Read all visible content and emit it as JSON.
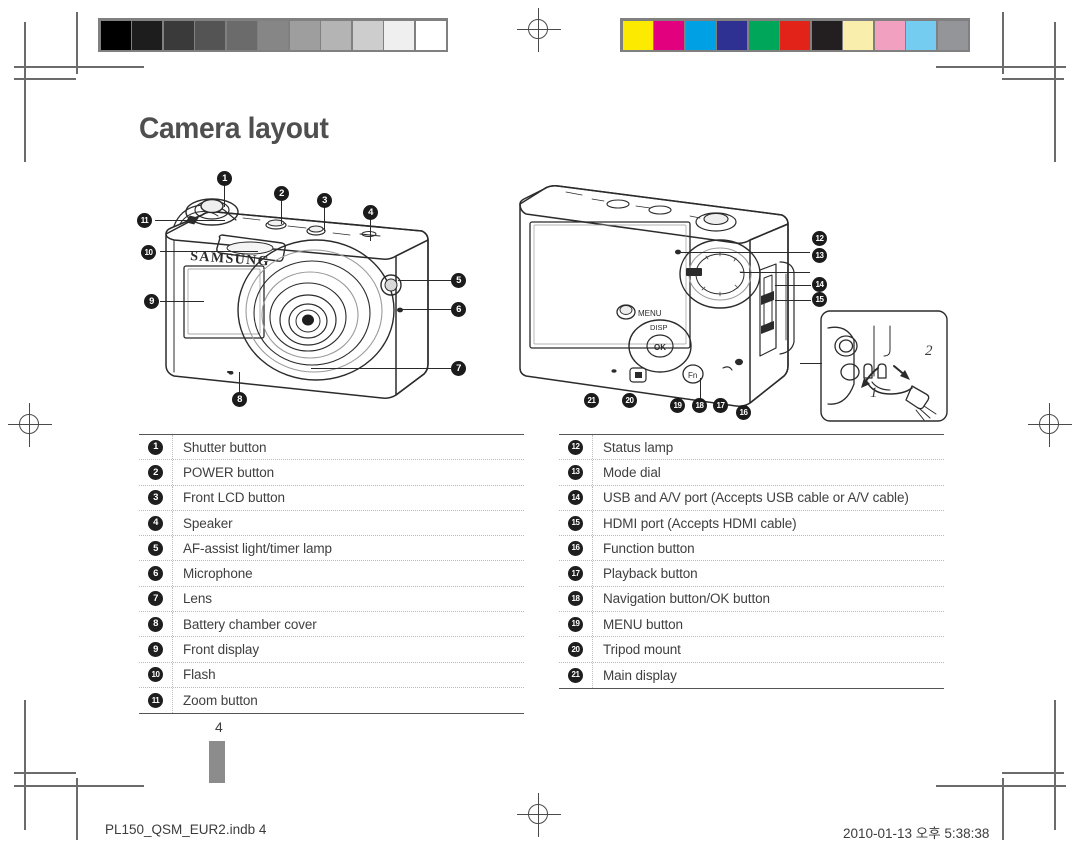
{
  "document": {
    "page_title": "Camera layout",
    "page_number": "4",
    "footer_file": "PL150_QSM_EUR2.indb   4",
    "footer_timestamp": "2010-01-13   오후 5:38:38"
  },
  "print_strips": {
    "grayscale_label": "grayscale-control-strip",
    "grayscale": [
      "#000000",
      "#1d1d1d",
      "#3a3a3a",
      "#545454",
      "#6b6b6b",
      "#868686",
      "#9e9e9e",
      "#b4b4b4",
      "#cdcdcd",
      "#efefef",
      "#ffffff"
    ],
    "color_label": "color-control-strip",
    "colors": [
      "#fcea00",
      "#e3007f",
      "#00a0e4",
      "#2e3192",
      "#00a65a",
      "#e2231a",
      "#231f20",
      "#faeeac",
      "#f2a0c0",
      "#74cdf0",
      "#939598"
    ]
  },
  "illustrations": {
    "front": {
      "name": "camera-front-illustration",
      "brand_text": "SAMSUNG",
      "callouts": [
        "1",
        "2",
        "3",
        "4",
        "5",
        "6",
        "7",
        "8",
        "9",
        "10",
        "11"
      ]
    },
    "rear": {
      "name": "camera-rear-illustration",
      "menu_text": "MENU",
      "disp_text": "DISP",
      "ok_text": "OK",
      "fn_text": "Fn",
      "callouts": [
        "12",
        "13",
        "14",
        "15",
        "16",
        "17",
        "18",
        "19",
        "20",
        "21"
      ]
    },
    "inset": {
      "name": "cable-connection-inset",
      "step_one": "1",
      "step_two": "2"
    }
  },
  "legend_left": [
    {
      "num": "1",
      "label": "Shutter button"
    },
    {
      "num": "2",
      "label": "POWER button"
    },
    {
      "num": "3",
      "label": "Front LCD button"
    },
    {
      "num": "4",
      "label": "Speaker"
    },
    {
      "num": "5",
      "label": "AF-assist light/timer lamp"
    },
    {
      "num": "6",
      "label": "Microphone"
    },
    {
      "num": "7",
      "label": "Lens"
    },
    {
      "num": "8",
      "label": "Battery chamber cover"
    },
    {
      "num": "9",
      "label": "Front display"
    },
    {
      "num": "10",
      "label": "Flash"
    },
    {
      "num": "11",
      "label": "Zoom button"
    }
  ],
  "legend_right": [
    {
      "num": "12",
      "label": "Status lamp"
    },
    {
      "num": "13",
      "label": "Mode dial"
    },
    {
      "num": "14",
      "label": "USB and A/V port (Accepts USB cable or A/V cable)"
    },
    {
      "num": "15",
      "label": "HDMI port (Accepts HDMI cable)"
    },
    {
      "num": "16",
      "label": "Function button"
    },
    {
      "num": "17",
      "label": "Playback button"
    },
    {
      "num": "18",
      "label": "Navigation button/OK button"
    },
    {
      "num": "19",
      "label": "MENU button"
    },
    {
      "num": "20",
      "label": "Tripod mount"
    },
    {
      "num": "21",
      "label": "Main display"
    }
  ]
}
